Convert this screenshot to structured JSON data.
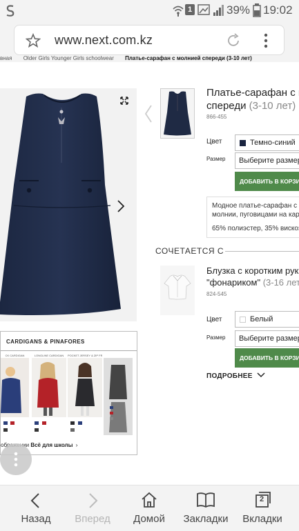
{
  "status_bar": {
    "battery": "39%",
    "time": "19:02",
    "notification_count": "1"
  },
  "browser": {
    "url": "www.next.com.kz"
  },
  "breadcrumb": {
    "items": [
      "вная",
      "Older Girls Younger Girls schoolwear"
    ],
    "current": "Платье-сарафан с молнией спереди (3-10 лет)"
  },
  "product": {
    "title_line1": "Платье-сарафан с мол",
    "title_line2": "спереди",
    "age": "(3-10 лет)",
    "code": "866-455",
    "color_label": "Цвет",
    "color_value": "Темно-синий",
    "color_swatch": "#1a2440",
    "size_label": "Размер",
    "size_placeholder": "Выберите размер",
    "add_button": "ДОБАВИТЬ В КОРЗИНУ",
    "desc_line1": "Модное платье-сарафан с",
    "desc_line2": "молнии, пуговицами на кар",
    "desc_line3": "65% полиэстер, 35% вискоз"
  },
  "matches": {
    "heading": "СОЧЕТАЕТСЯ С",
    "title_line1": "Блузка с коротким рук",
    "title_line2": "\"фонариком\"",
    "age": "(3-16 лет",
    "code": "824-545",
    "color_label": "Цвет",
    "color_value": "Белый",
    "size_label": "Размер",
    "size_placeholder": "Выберите размер",
    "add_button": "ДОБАВИТЬ В КОРЗИНУ",
    "more": "ПОДРОБНЕЕ"
  },
  "banner": {
    "title": "CARDIGANS & PINAFORES",
    "col_labels": [
      "CK CARDIGAN",
      "LONGLINE CARDIGAN",
      "POCKET JERSEY & ZIP FRONT PINAFORES",
      ""
    ],
    "footer_prefix": "ображении",
    "footer_link": "Всё для школы"
  },
  "bottom_nav": [
    {
      "label": "Назад",
      "icon": "back-icon"
    },
    {
      "label": "Вперед",
      "icon": "forward-icon"
    },
    {
      "label": "Домой",
      "icon": "home-icon"
    },
    {
      "label": "Закладки",
      "icon": "bookmarks-icon"
    },
    {
      "label": "Вкладки",
      "icon": "tabs-icon",
      "badge": "2"
    }
  ],
  "colors": {
    "navy": "#1a2440",
    "green_button": "#4f8a4a"
  }
}
